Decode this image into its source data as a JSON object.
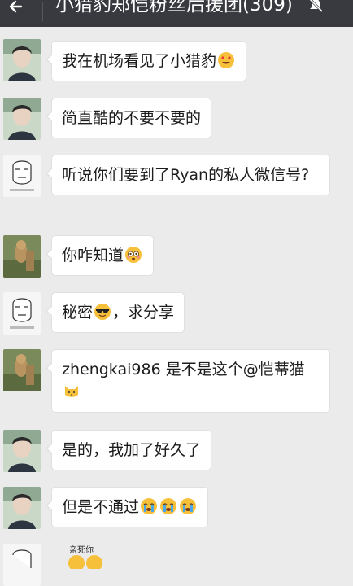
{
  "header": {
    "title": "小猎豹郑恺粉丝后援团",
    "member_count": "(309)",
    "back_icon": "back-arrow-icon",
    "mute_icon": "mute-bell-icon"
  },
  "messages": [
    {
      "avatar": "young-man-photo",
      "text": "我在机场看见了小猎豹",
      "emoji": "heart-eyes-emoji"
    },
    {
      "avatar": "young-man-photo",
      "text": "简直酷的不要不要的"
    },
    {
      "avatar": "cartoon-face-sticker",
      "text": "听说你们要到了Ryan的私人微信号?"
    },
    {
      "avatar": "meerkat-photo",
      "text": "你咋知道",
      "emoji": "flushed-emoji"
    },
    {
      "avatar": "cartoon-face-sticker",
      "text_before": "秘密",
      "emoji": "sunglasses-emoji",
      "text_after": "，求分享"
    },
    {
      "avatar": "meerkat-photo",
      "text": "zhengkai986 是不是这个@恺蒂猫",
      "emoji": "cat-emoji"
    },
    {
      "avatar": "young-man-photo",
      "text": "是的，我加了好久了"
    },
    {
      "avatar": "young-man-photo",
      "text": "但是不通过",
      "emoji": "crying-emoji"
    }
  ],
  "partial_sticker": {
    "label": "亲死你"
  }
}
